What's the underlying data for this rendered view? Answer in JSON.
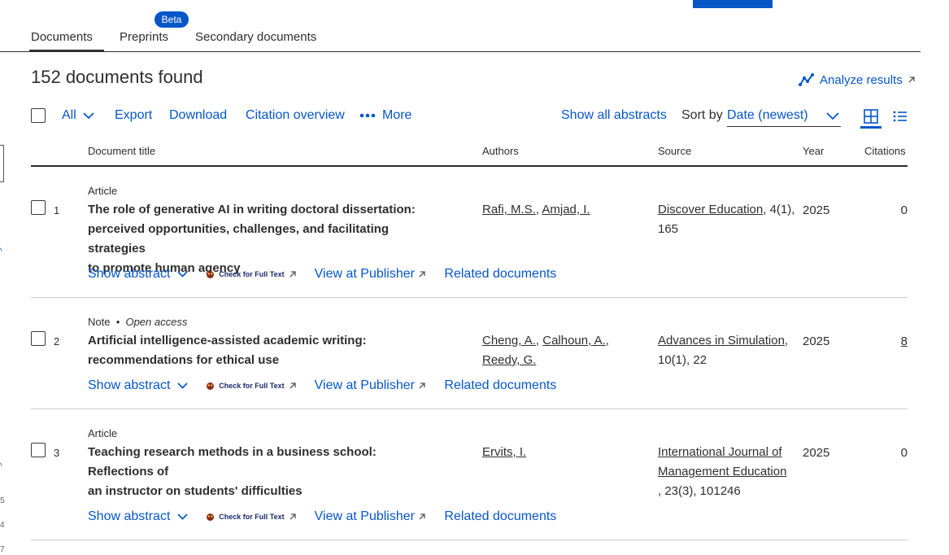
{
  "tabs": [
    {
      "label": "Documents"
    },
    {
      "label": "Preprints",
      "badge": "Beta"
    },
    {
      "label": "Secondary documents"
    }
  ],
  "results": {
    "count_title": "152 documents found",
    "analyze_label": "Analyze results"
  },
  "toolbar": {
    "select_all": "All",
    "export": "Export",
    "download": "Download",
    "citation_overview": "Citation overview",
    "more": "More",
    "show_all_abstracts": "Show all abstracts",
    "sort_by_label": "Sort by",
    "sort_value": "Date (newest)"
  },
  "columns": {
    "title": "Document title",
    "authors": "Authors",
    "source": "Source",
    "year": "Year",
    "citations": "Citations"
  },
  "row_actions": {
    "show_abstract": "Show abstract",
    "check_full_text": "Check for Full Text",
    "view_publisher": "View at Publisher",
    "related": "Related documents"
  },
  "documents": [
    {
      "num": "1",
      "type": "Article",
      "access": "",
      "title_lines": [
        "The role of generative AI in writing doctoral dissertation:",
        "perceived opportunities, challenges, and facilitating strategies",
        "to promote human agency"
      ],
      "authors": [
        "Rafi, M.S.",
        "Amjad, I."
      ],
      "source_name": "Discover Education",
      "source_detail": ", 4(1),",
      "source_line2": "165",
      "year": "2025",
      "citations": "0"
    },
    {
      "num": "2",
      "type": "Note",
      "access": "Open access",
      "title_lines": [
        "Artificial intelligence-assisted academic writing:",
        "recommendations for ethical use"
      ],
      "authors": [
        "Cheng, A.",
        "Calhoun, A.",
        "Reedy, G."
      ],
      "source_name": "Advances in Simulation",
      "source_detail": ",",
      "source_line2": "10(1), 22",
      "year": "2025",
      "citations": "8"
    },
    {
      "num": "3",
      "type": "Article",
      "access": "",
      "title_lines": [
        "Teaching research methods in a business school: Reflections of",
        "an instructor on students' difficulties"
      ],
      "authors": [
        "Ervits, I."
      ],
      "source_name_lines": [
        "International Journal of",
        "Management Education"
      ],
      "source_line2": ", 23(3), 101246",
      "year": "2025",
      "citations": "0"
    }
  ],
  "edge_numbers": [
    "5",
    "4",
    "7"
  ],
  "colors": {
    "accent": "#0656c8",
    "text": "#2e2e2e",
    "rule": "#cccccc"
  }
}
